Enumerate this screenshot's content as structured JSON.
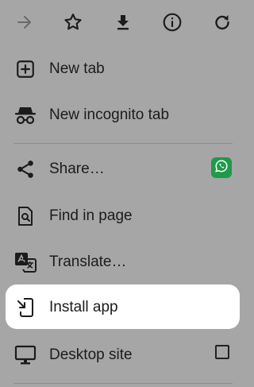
{
  "toolbar": {
    "buttons": [
      {
        "name": "forward-icon"
      },
      {
        "name": "star-icon"
      },
      {
        "name": "download-icon"
      },
      {
        "name": "info-icon"
      },
      {
        "name": "refresh-icon"
      }
    ]
  },
  "menu": {
    "items": [
      {
        "label": "New tab",
        "icon": "plus-square-icon"
      },
      {
        "label": "New incognito tab",
        "icon": "incognito-icon"
      },
      {
        "label": "Share…",
        "icon": "share-icon",
        "badge_icon": "whatsapp-icon"
      },
      {
        "label": "Find in page",
        "icon": "find-in-page-icon"
      },
      {
        "label": "Translate…",
        "icon": "translate-icon"
      },
      {
        "label": "Install app",
        "icon": "install-app-icon",
        "highlighted": true
      },
      {
        "label": "Desktop site",
        "icon": "desktop-icon",
        "checkbox_checked": false
      }
    ]
  },
  "colors": {
    "scrim": "#a6a6a6",
    "highlight": "#ffffff",
    "whatsapp_badge": "#1e9a4a",
    "text": "#1c1c1c"
  }
}
